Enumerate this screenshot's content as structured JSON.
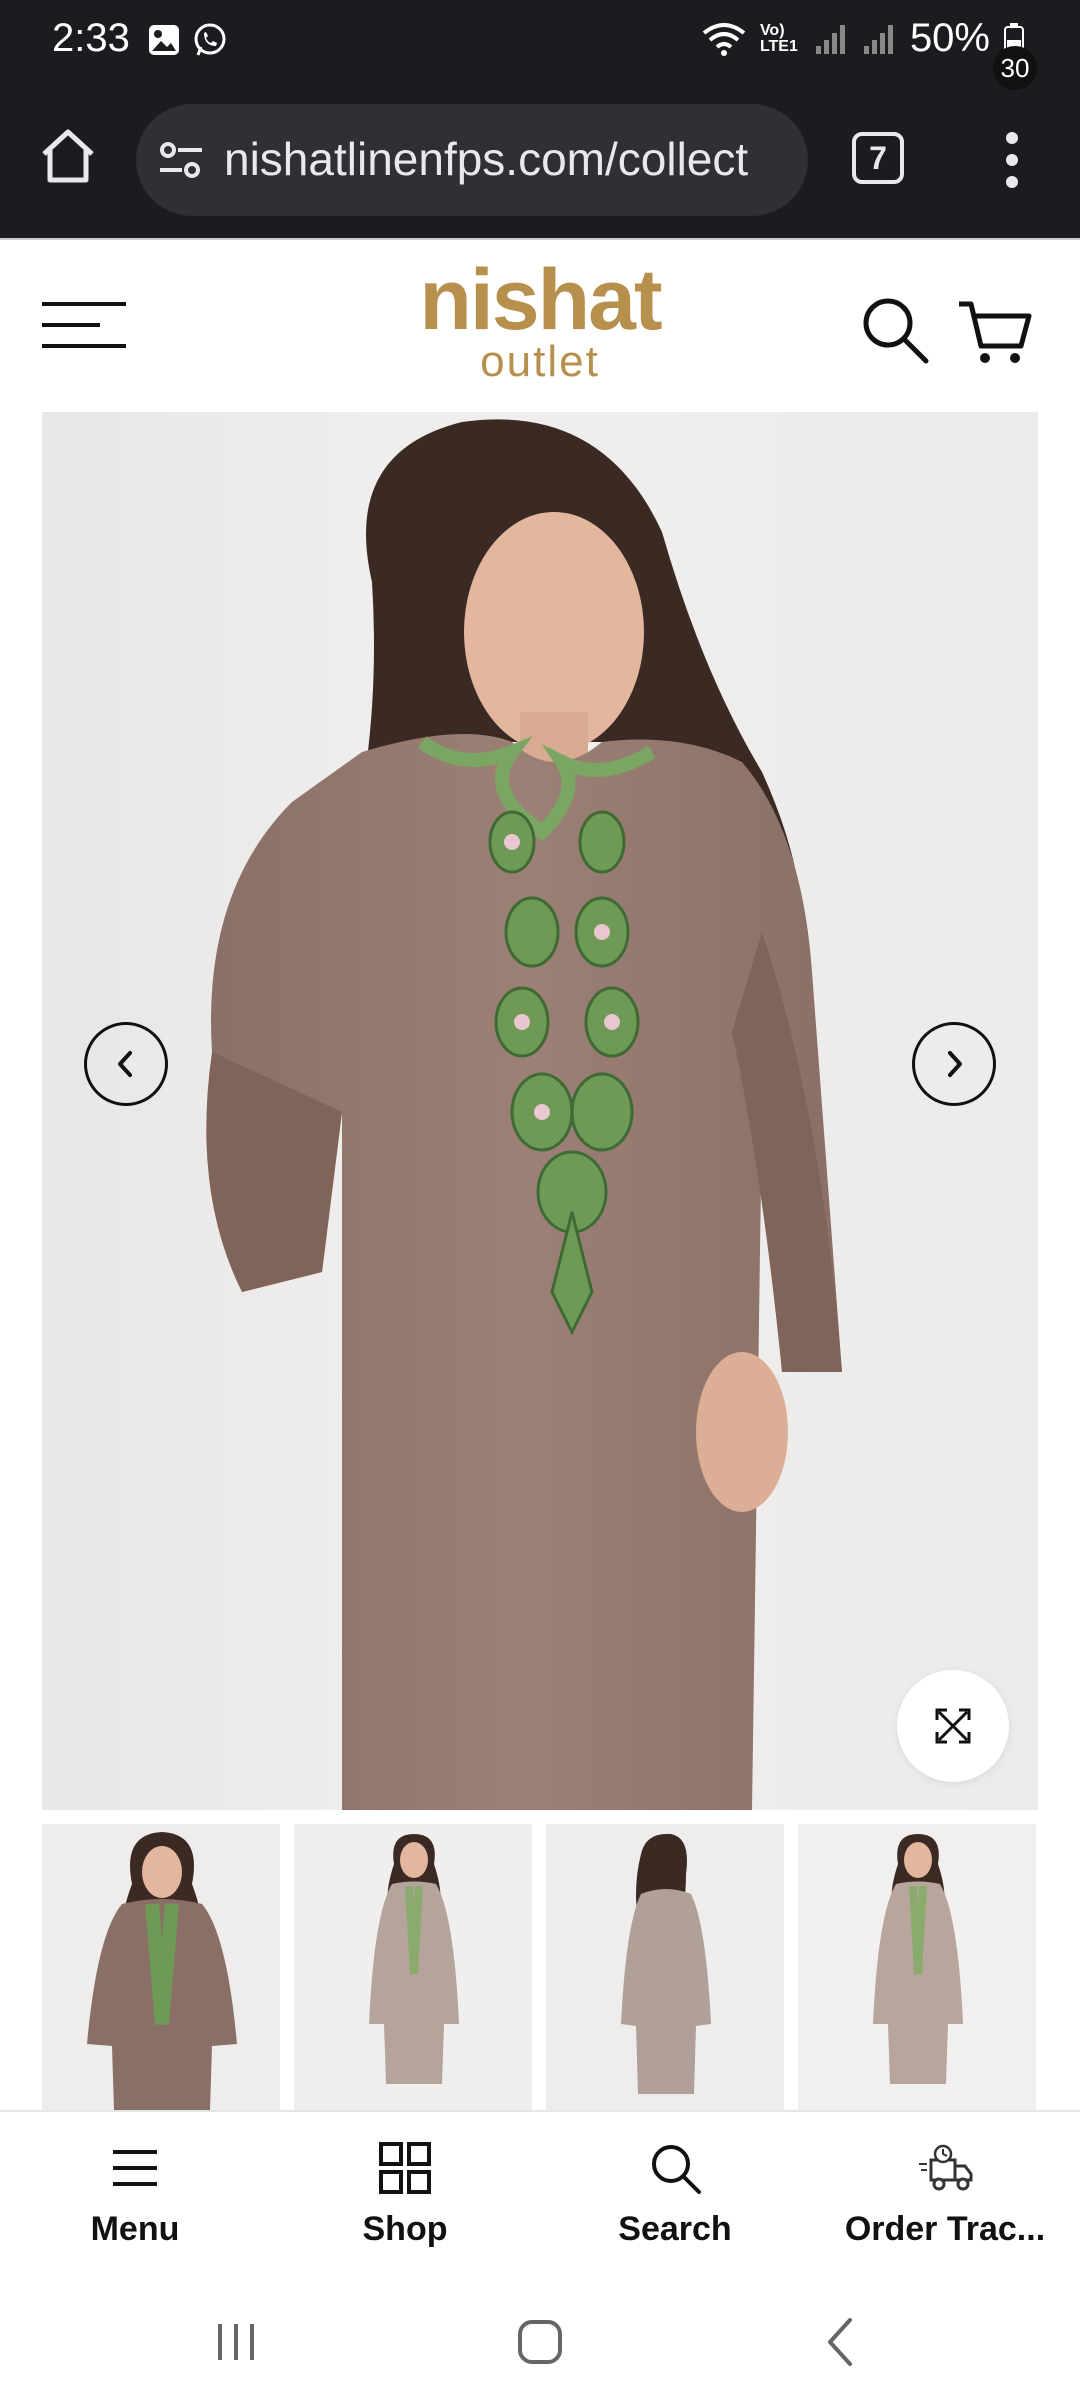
{
  "status_bar": {
    "time": "2:33",
    "network": "Vo) LTE1",
    "battery": "50%"
  },
  "browser": {
    "url": "nishatlinenfps.com/collect",
    "tab_count": "7"
  },
  "header": {
    "logo_line1": "nishat",
    "logo_line2": "outlet",
    "cart_count": "30",
    "logo_color": "#b8904d"
  },
  "product": {
    "thumbnails": [
      "thumb-1",
      "thumb-2",
      "thumb-3",
      "thumb-4"
    ]
  },
  "bottom_nav": {
    "items": [
      {
        "label": "Menu",
        "icon": "menu-icon"
      },
      {
        "label": "Shop",
        "icon": "grid-icon"
      },
      {
        "label": "Search",
        "icon": "search-icon"
      },
      {
        "label": "Order Trac...",
        "icon": "delivery-truck-icon"
      }
    ]
  }
}
